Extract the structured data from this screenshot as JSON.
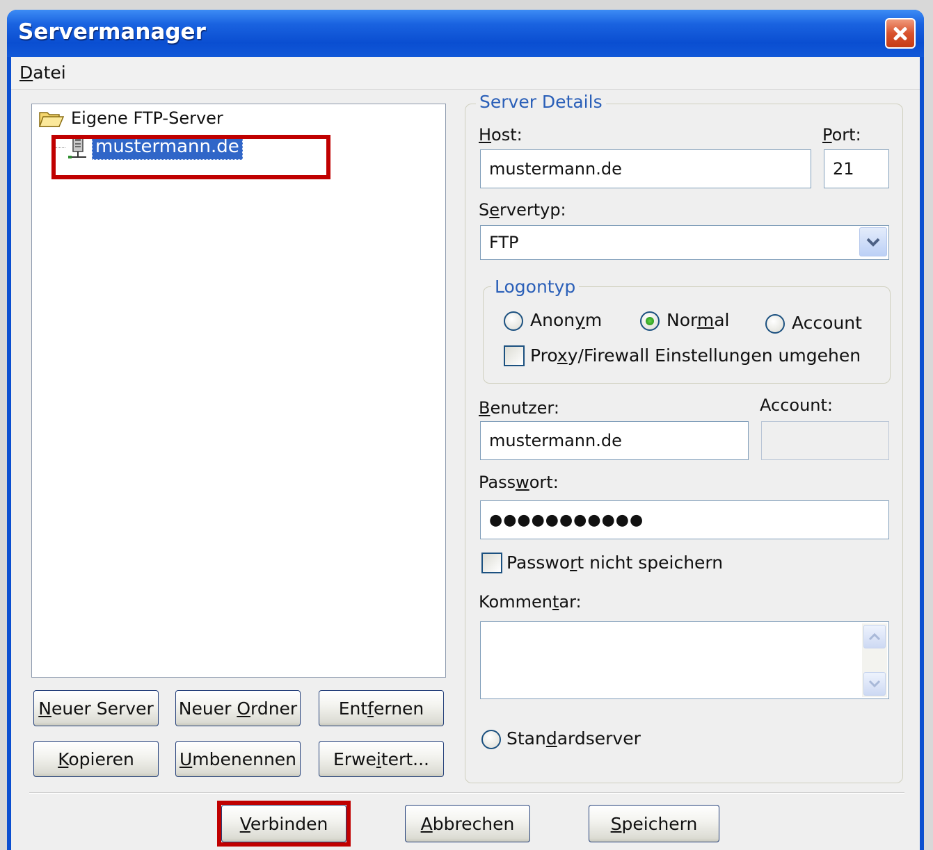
{
  "window": {
    "title": "Servermanager"
  },
  "menu": {
    "file": {
      "mnemonic": "D",
      "rest": "atei"
    }
  },
  "tree": {
    "root_label": "Eigene FTP-Server",
    "node_label": "mustermann.de"
  },
  "left_buttons": {
    "new_server": {
      "mn": "N",
      "rest": "euer Server"
    },
    "new_folder": {
      "pre": "Neuer ",
      "mn": "O",
      "rest": "rdner"
    },
    "remove": {
      "pre": "Ent",
      "mn": "f",
      "rest": "ernen"
    },
    "copy": {
      "mn": "K",
      "rest": "opieren"
    },
    "rename": {
      "mn": "U",
      "rest": "mbenennen"
    },
    "advanced": {
      "pre": "Erwe",
      "mn": "i",
      "rest": "tert..."
    }
  },
  "details": {
    "legend": "Server Details",
    "host_label": {
      "mn": "H",
      "rest": "ost:"
    },
    "host_value": "mustermann.de",
    "port_label": {
      "mn": "P",
      "rest": "ort:"
    },
    "port_value": "21",
    "servertype_label": {
      "pre": "S",
      "mn": "e",
      "rest": "rvertyp:"
    },
    "servertype_value": "FTP",
    "logon": {
      "legend": "Logontyp",
      "anonym": {
        "pre": "Anon",
        "mn": "y",
        "rest": "m"
      },
      "normal": {
        "pre": "Nor",
        "mn": "m",
        "rest": "al"
      },
      "account": "Account",
      "selected": "normal",
      "bypass": {
        "pre": "Pro",
        "mn": "x",
        "rest": "y/Firewall Einstellungen umgehen"
      }
    },
    "user_label": {
      "mn": "B",
      "rest": "enutzer:"
    },
    "user_value": "mustermann.de",
    "account_label": "Account:",
    "password_label": {
      "pre": "Pass",
      "mn": "w",
      "rest": "ort:"
    },
    "password_value": "●●●●●●●●●●●",
    "no_save_password": {
      "pre": "Passwo",
      "mn": "r",
      "rest": "t nicht speichern"
    },
    "comment_label": {
      "pre": "Kommen",
      "mn": "t",
      "rest": "ar:"
    },
    "default_server": {
      "pre": "Stan",
      "mn": "d",
      "rest": "ardserver"
    }
  },
  "footer": {
    "connect": {
      "mn": "V",
      "rest": "erbinden"
    },
    "cancel": {
      "mn": "A",
      "rest": "bbrechen"
    },
    "save": {
      "mn": "S",
      "rest": "peichern"
    }
  },
  "colors": {
    "highlight": "#c00000",
    "selection": "#3066c8",
    "legend": "#2a5fb8",
    "titlebar": "#0a4ed1"
  },
  "icons": {
    "close": "close-icon",
    "folder": "folder-open-icon",
    "server": "server-computer-icon",
    "dropdown": "chevron-down-icon"
  }
}
